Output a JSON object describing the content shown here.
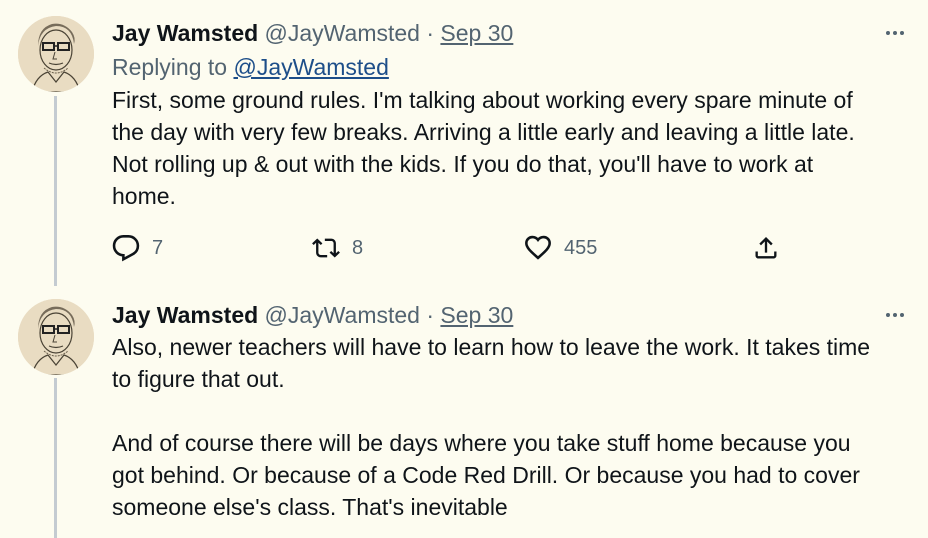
{
  "tweets": [
    {
      "author_name": "Jay Wamsted",
      "author_handle": "@JayWamsted",
      "separator": "·",
      "date": "Sep 30",
      "replying_prefix": "Replying to ",
      "replying_to": "@JayWamsted",
      "text": "First, some ground rules. I'm talking about working every spare minute of\nthe day with very few breaks. Arriving a little early and leaving a little late.\nNot rolling up & out with the kids. If you do that, you'll have to work at\nhome.",
      "reply_count": "7",
      "retweet_count": "8",
      "like_count": "455"
    },
    {
      "author_name": "Jay Wamsted",
      "author_handle": "@JayWamsted",
      "separator": "·",
      "date": "Sep 30",
      "text": "Also, newer teachers will have to learn how to leave the work. It takes time\nto figure that out.\n\nAnd of course there will be days where you take stuff home because you\ngot behind. Or because of a Code Red Drill. Or because you had to cover\nsomeone else's class. That's inevitable"
    }
  ],
  "icons": {
    "more": "more-icon",
    "reply": "reply-icon",
    "retweet": "retweet-icon",
    "like": "heart-icon",
    "share": "share-icon"
  },
  "colors": {
    "background": "#fdfcf0",
    "text": "#0f1419",
    "secondary": "#536471",
    "link": "#1d4e89",
    "thread_line": "#c4cbd1"
  }
}
